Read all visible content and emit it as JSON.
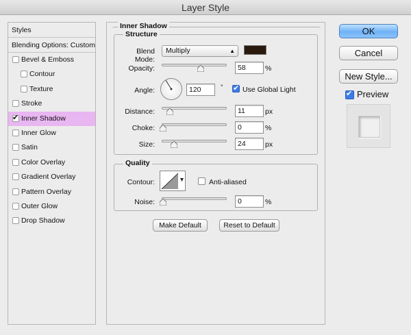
{
  "window": {
    "title": "Layer Style"
  },
  "sidebar": {
    "header": "Styles",
    "blending_options": "Blending Options: Custom",
    "items": [
      {
        "label": "Bevel & Emboss",
        "checked": false,
        "indent": false,
        "selected": false
      },
      {
        "label": "Contour",
        "checked": false,
        "indent": true,
        "selected": false
      },
      {
        "label": "Texture",
        "checked": false,
        "indent": true,
        "selected": false
      },
      {
        "label": "Stroke",
        "checked": false,
        "indent": false,
        "selected": false
      },
      {
        "label": "Inner Shadow",
        "checked": true,
        "indent": false,
        "selected": true
      },
      {
        "label": "Inner Glow",
        "checked": false,
        "indent": false,
        "selected": false
      },
      {
        "label": "Satin",
        "checked": false,
        "indent": false,
        "selected": false
      },
      {
        "label": "Color Overlay",
        "checked": false,
        "indent": false,
        "selected": false
      },
      {
        "label": "Gradient Overlay",
        "checked": false,
        "indent": false,
        "selected": false
      },
      {
        "label": "Pattern Overlay",
        "checked": false,
        "indent": false,
        "selected": false
      },
      {
        "label": "Outer Glow",
        "checked": false,
        "indent": false,
        "selected": false
      },
      {
        "label": "Drop Shadow",
        "checked": false,
        "indent": false,
        "selected": false
      }
    ]
  },
  "inner_shadow": {
    "title": "Inner Shadow",
    "structure": {
      "title": "Structure",
      "blend_mode_label": "Blend Mode:",
      "blend_mode_value": "Multiply",
      "shadow_color": "#2a1a0e",
      "opacity_label": "Opacity:",
      "opacity_value": "58",
      "opacity_unit": "%",
      "opacity_fraction": 0.58,
      "angle_label": "Angle:",
      "angle_value": "120",
      "angle_unit": "°",
      "use_global_light_label": "Use Global Light",
      "use_global_light_checked": true,
      "distance_label": "Distance:",
      "distance_value": "11",
      "distance_unit": "px",
      "choke_label": "Choke:",
      "choke_value": "0",
      "choke_unit": "%",
      "size_label": "Size:",
      "size_value": "24",
      "size_unit": "px"
    },
    "quality": {
      "title": "Quality",
      "contour_label": "Contour:",
      "anti_aliased_label": "Anti-aliased",
      "anti_aliased_checked": false,
      "noise_label": "Noise:",
      "noise_value": "0",
      "noise_unit": "%"
    },
    "make_default_label": "Make Default",
    "reset_default_label": "Reset to Default"
  },
  "actions": {
    "ok_label": "OK",
    "cancel_label": "Cancel",
    "new_style_label": "New Style...",
    "preview_label": "Preview",
    "preview_checked": true
  },
  "colors": {
    "selected_item": "#e8b6f0",
    "default_button": "#6fb2f6",
    "checkbox_accent": "#3d7ce6"
  }
}
